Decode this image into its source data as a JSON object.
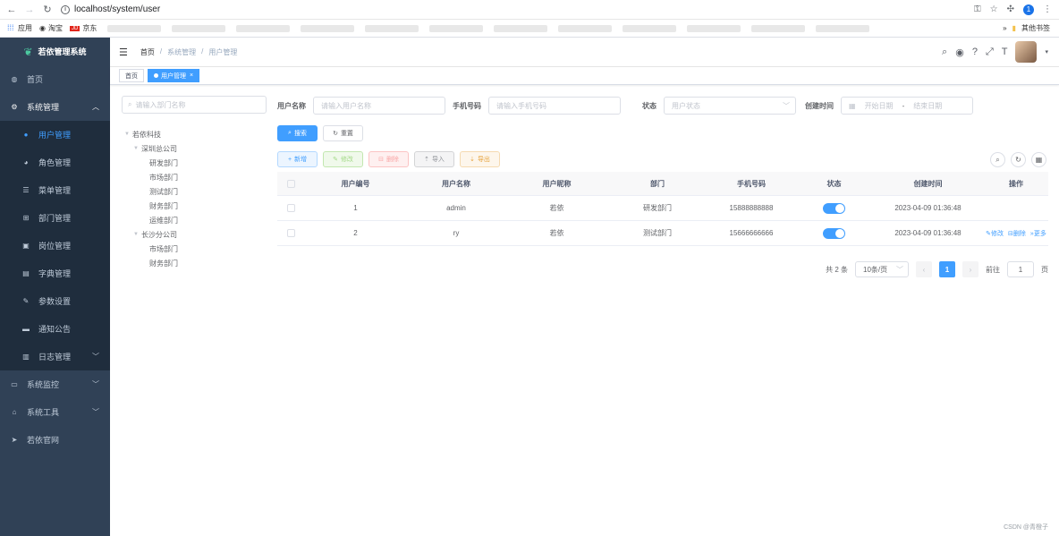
{
  "browser": {
    "url": "localhost/system/user",
    "profile_initial": "1"
  },
  "bookmarks": {
    "apps": "应用",
    "taobao": "淘宝",
    "jd_logo": "JD",
    "jd": "京东",
    "other": "其他书签"
  },
  "sidebar": {
    "title": "若依管理系统",
    "items": [
      {
        "label": "首页",
        "icon": "dashboard-icon"
      },
      {
        "label": "系统管理",
        "icon": "gear-icon"
      },
      {
        "label": "用户管理",
        "icon": "user-icon"
      },
      {
        "label": "角色管理",
        "icon": "peoples-icon"
      },
      {
        "label": "菜单管理",
        "icon": "tree-table-icon"
      },
      {
        "label": "部门管理",
        "icon": "tree-icon"
      },
      {
        "label": "岗位管理",
        "icon": "post-icon"
      },
      {
        "label": "字典管理",
        "icon": "dict-icon"
      },
      {
        "label": "参数设置",
        "icon": "edit-icon"
      },
      {
        "label": "通知公告",
        "icon": "message-icon"
      },
      {
        "label": "日志管理",
        "icon": "log-icon"
      },
      {
        "label": "系统监控",
        "icon": "monitor-icon"
      },
      {
        "label": "系统工具",
        "icon": "tool-icon"
      },
      {
        "label": "若依官网",
        "icon": "guide-icon"
      }
    ]
  },
  "breadcrumb": {
    "home": "首页",
    "sep": "/",
    "section": "系统管理",
    "page": "用户管理"
  },
  "tags": {
    "home": "首页",
    "current": "用户管理",
    "close": "×"
  },
  "dept_tree": {
    "search_placeholder": "请输入部门名称",
    "root": "若依科技",
    "branches": [
      {
        "name": "深圳总公司",
        "children": [
          "研发部门",
          "市场部门",
          "测试部门",
          "财务部门",
          "运维部门"
        ]
      },
      {
        "name": "长沙分公司",
        "children": [
          "市场部门",
          "财务部门"
        ]
      }
    ]
  },
  "search_form": {
    "username_label": "用户名称",
    "username_placeholder": "请输入用户名称",
    "phone_label": "手机号码",
    "phone_placeholder": "请输入手机号码",
    "status_label": "状态",
    "status_placeholder": "用户状态",
    "created_label": "创建时间",
    "start_placeholder": "开始日期",
    "range_sep": "-",
    "end_placeholder": "结束日期",
    "search_button": "搜索",
    "reset_button": "重置"
  },
  "toolbar": {
    "add": "新增",
    "edit": "修改",
    "delete": "删除",
    "import": "导入",
    "export": "导出"
  },
  "table": {
    "headers": [
      "用户编号",
      "用户名称",
      "用户昵称",
      "部门",
      "手机号码",
      "状态",
      "创建时间",
      "操作"
    ],
    "rows": [
      {
        "id": "1",
        "username": "admin",
        "nickname": "若依",
        "dept": "研发部门",
        "phone": "15888888888",
        "status": true,
        "created": "2023-04-09 01:36:48",
        "ops": []
      },
      {
        "id": "2",
        "username": "ry",
        "nickname": "若依",
        "dept": "测试部门",
        "phone": "15666666666",
        "status": true,
        "created": "2023-04-09 01:36:48",
        "ops": [
          "修改",
          "删除",
          "更多"
        ]
      }
    ]
  },
  "pagination": {
    "total": "共 2 条",
    "page_size": "10条/页",
    "current": "1",
    "goto_label": "前往",
    "goto_value": "1",
    "page_unit": "页"
  },
  "watermark": "CSDN @青橙子"
}
